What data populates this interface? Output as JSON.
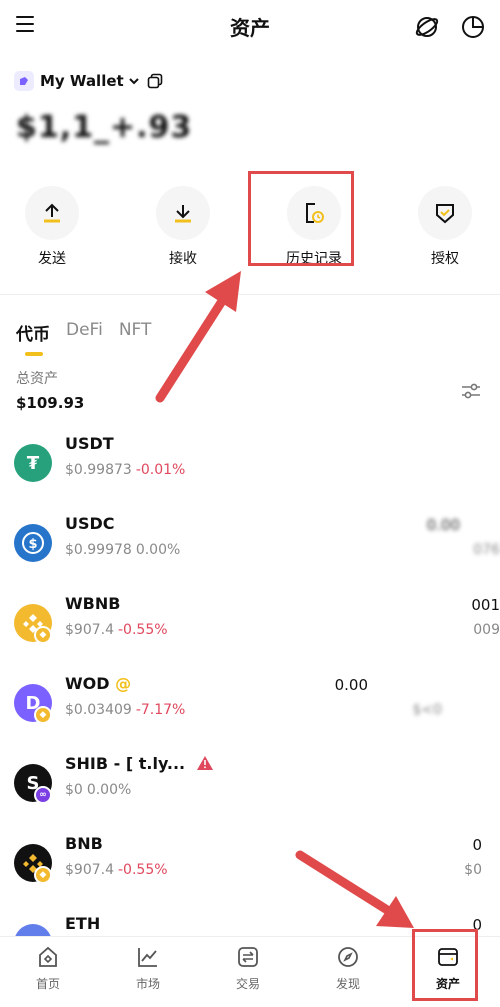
{
  "header": {
    "title": "资产",
    "menu_icon": "menu-icon",
    "right_icons": [
      "globe-icon",
      "pie-chart-icon"
    ]
  },
  "wallet": {
    "name": "My Wallet",
    "balance_masked": "$1,1_+.93"
  },
  "actions": [
    {
      "label": "发送",
      "icon": "upload-arrow-icon"
    },
    {
      "label": "接收",
      "icon": "download-arrow-icon"
    },
    {
      "label": "历史记录",
      "icon": "history-clock-icon"
    },
    {
      "label": "授权",
      "icon": "authorize-shield-icon"
    }
  ],
  "tabs": [
    {
      "label": "代币",
      "active": true
    },
    {
      "label": "DeFi",
      "active": false
    },
    {
      "label": "NFT",
      "active": false
    }
  ],
  "total": {
    "label": "总资产",
    "value": "$109.93"
  },
  "tokens": [
    {
      "symbol": "USDT",
      "price": "$0.99873",
      "change": "-0.01%",
      "amount": "",
      "value": "",
      "color": "#26a17b"
    },
    {
      "symbol": "USDC",
      "price": "$0.99978",
      "change": "0.00%",
      "amount": "0.00",
      "value": "076",
      "color": "#2775ca"
    },
    {
      "symbol": "WBNB",
      "price": "$907.4",
      "change": "-0.55%",
      "amount": "001",
      "value": "009",
      "color": "#f3ba2f"
    },
    {
      "symbol": "WOD",
      "price": "$0.03409",
      "change": "-7.17%",
      "amount": "0.00",
      "value": "$<0",
      "color": "#7b61ff"
    },
    {
      "symbol": "SHIB - [ t.ly...",
      "price": "$0",
      "change": "0.00%",
      "amount": "",
      "value": "",
      "color": "#111111"
    },
    {
      "symbol": "BNB",
      "price": "$907.4",
      "change": "-0.55%",
      "amount": "0",
      "value": "$0",
      "color": "#111111"
    },
    {
      "symbol": "ETH",
      "price": "",
      "change": "",
      "amount": "0",
      "value": "",
      "color": "#627eea"
    }
  ],
  "bottom_nav": [
    {
      "label": "首页",
      "icon": "home-icon",
      "active": false
    },
    {
      "label": "市场",
      "icon": "market-chart-icon",
      "active": false
    },
    {
      "label": "交易",
      "icon": "swap-icon",
      "active": false
    },
    {
      "label": "发现",
      "icon": "discover-compass-icon",
      "active": false
    },
    {
      "label": "资产",
      "icon": "wallet-assets-icon",
      "active": true
    }
  ],
  "colors": {
    "accent": "#f2c01c",
    "negative": "#e0485e",
    "annotation": "#e04a4a"
  }
}
